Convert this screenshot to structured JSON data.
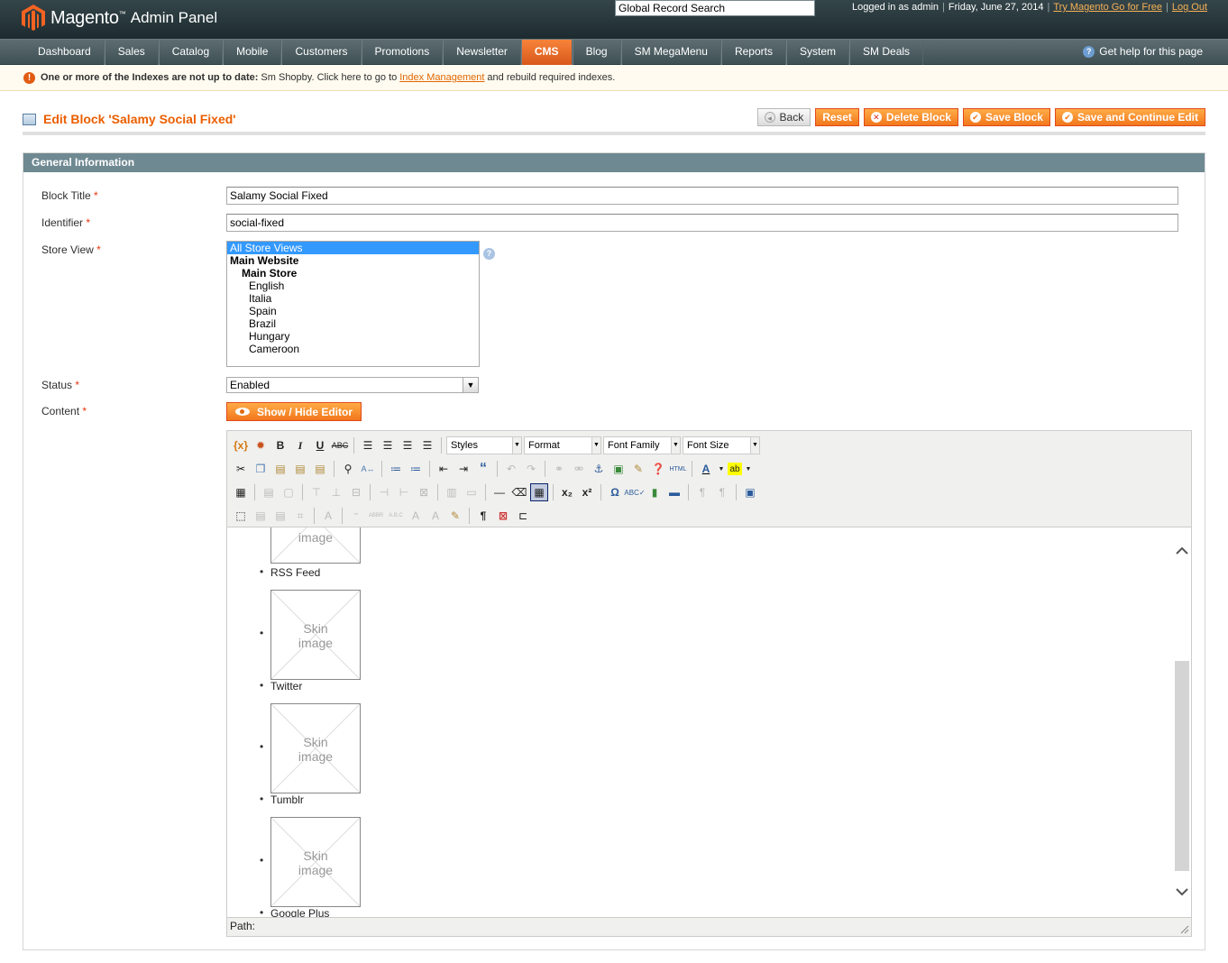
{
  "header": {
    "brand": "Magento",
    "panel": "Admin Panel",
    "search_value": "Global Record Search",
    "logged_in": "Logged in as admin",
    "date": "Friday, June 27, 2014",
    "try_link": "Try Magento Go for Free",
    "logout_link": "Log Out"
  },
  "nav": {
    "items": [
      "Dashboard",
      "Sales",
      "Catalog",
      "Mobile",
      "Customers",
      "Promotions",
      "Newsletter",
      "CMS",
      "Blog",
      "SM MegaMenu",
      "Reports",
      "System",
      "SM Deals"
    ],
    "active": "CMS",
    "help": "Get help for this page"
  },
  "notice": {
    "bold": "One or more of the Indexes are not up to date:",
    "text1": "Sm Shopby. Click here to go to",
    "link": "Index Management",
    "text2": "and rebuild required indexes."
  },
  "page": {
    "title": "Edit Block 'Salamy Social Fixed'",
    "buttons": {
      "back": "Back",
      "reset": "Reset",
      "delete": "Delete Block",
      "save": "Save Block",
      "save_continue": "Save and Continue Edit"
    }
  },
  "form": {
    "section_title": "General Information",
    "block_title_label": "Block Title",
    "block_title_value": "Salamy Social Fixed",
    "identifier_label": "Identifier",
    "identifier_value": "social-fixed",
    "store_view_label": "Store View",
    "store_views": [
      "All Store Views",
      "Main Website",
      "Main Store",
      "English",
      "Italia",
      "Spain",
      "Brazil",
      "Hungary",
      "Cameroon"
    ],
    "status_label": "Status",
    "status_value": "Enabled",
    "content_label": "Content",
    "req": "*",
    "show_hide": "Show / Hide Editor"
  },
  "editor": {
    "dropdowns": [
      "Styles",
      "Format",
      "Font Family",
      "Font Size"
    ],
    "items": [
      "RSS Feed",
      "Twitter",
      "Tumblr",
      "Google Plus"
    ],
    "skin_line1": "Skin",
    "skin_line2": "image",
    "path": "Path:"
  },
  "colors": {
    "accent": "#eb5e00",
    "nav_active": "#e9691e",
    "section_header": "#6f8992",
    "header_bg": "#26363b"
  }
}
